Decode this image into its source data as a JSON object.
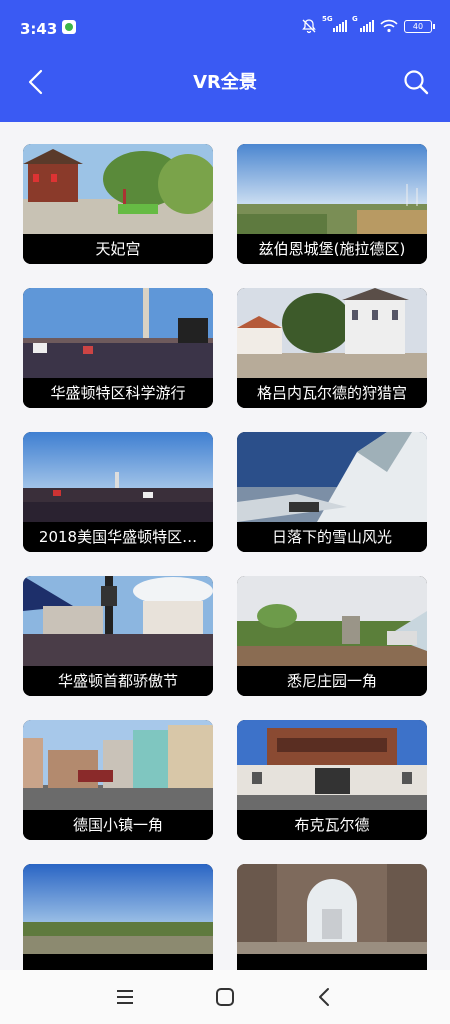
{
  "status_bar": {
    "time": "3:43",
    "network_1": "5G",
    "network_2": "G",
    "battery": "40"
  },
  "app_bar": {
    "title": "VR全景"
  },
  "cards": [
    {
      "title": "天妃宫",
      "scene": "temple"
    },
    {
      "title": "兹伯恩城堡(施拉德区)",
      "scene": "fields"
    },
    {
      "title": "华盛顿特区科学游行",
      "scene": "crowd"
    },
    {
      "title": "格吕内瓦尔德的狩猎宫",
      "scene": "palace"
    },
    {
      "title": "2018美国华盛顿特区…",
      "scene": "crowd2"
    },
    {
      "title": "日落下的雪山风光",
      "scene": "snow"
    },
    {
      "title": "华盛顿首都骄傲节",
      "scene": "pride"
    },
    {
      "title": "悉尼庄园一角",
      "scene": "garden"
    },
    {
      "title": "德国小镇一角",
      "scene": "town"
    },
    {
      "title": "布克瓦尔德",
      "scene": "building"
    },
    {
      "title": "",
      "scene": "aerial"
    },
    {
      "title": "",
      "scene": "ruins"
    }
  ]
}
